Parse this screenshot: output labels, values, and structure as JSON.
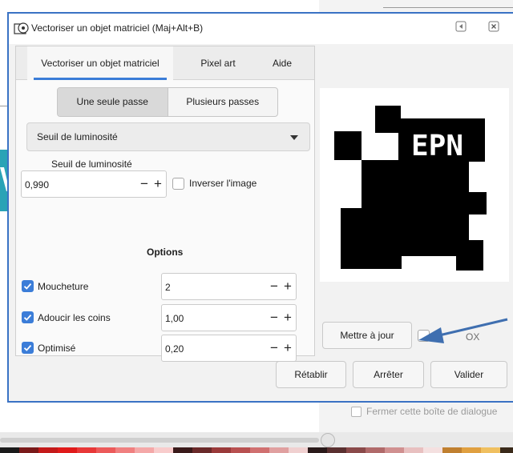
{
  "dialog": {
    "title": "Vectoriser un objet matriciel (Maj+Alt+B)",
    "tabs": [
      "Vectoriser un objet matriciel",
      "Pixel art",
      "Aide"
    ],
    "mode_buttons": [
      "Une seule passe",
      "Plusieurs passes"
    ],
    "method": "Seuil de luminosité",
    "threshold_label": "Seuil de luminosité",
    "threshold_value": "0,990",
    "invert_label": "Inverser l'image",
    "options_heading": "Options",
    "options": [
      {
        "label": "Moucheture",
        "checked": true,
        "value": "2"
      },
      {
        "label": "Adoucir les coins",
        "checked": true,
        "value": "1,00"
      },
      {
        "label": "Optimisé",
        "checked": true,
        "value": "0,20"
      }
    ],
    "preview_text": "EPN",
    "update_button": "Mettre à jour",
    "live_preview_label": "OX",
    "reset_button": "Rétablir",
    "stop_button": "Arrêter",
    "ok_button": "Valider"
  },
  "background": {
    "hint": "Fermer cette boîte de dialogue"
  },
  "spin_symbols": {
    "minus": "−",
    "plus": "+"
  },
  "colors": {
    "accent": "#3b7dd8",
    "border": "#3a72c4",
    "annotation_arrow": "#3f6fb0"
  }
}
